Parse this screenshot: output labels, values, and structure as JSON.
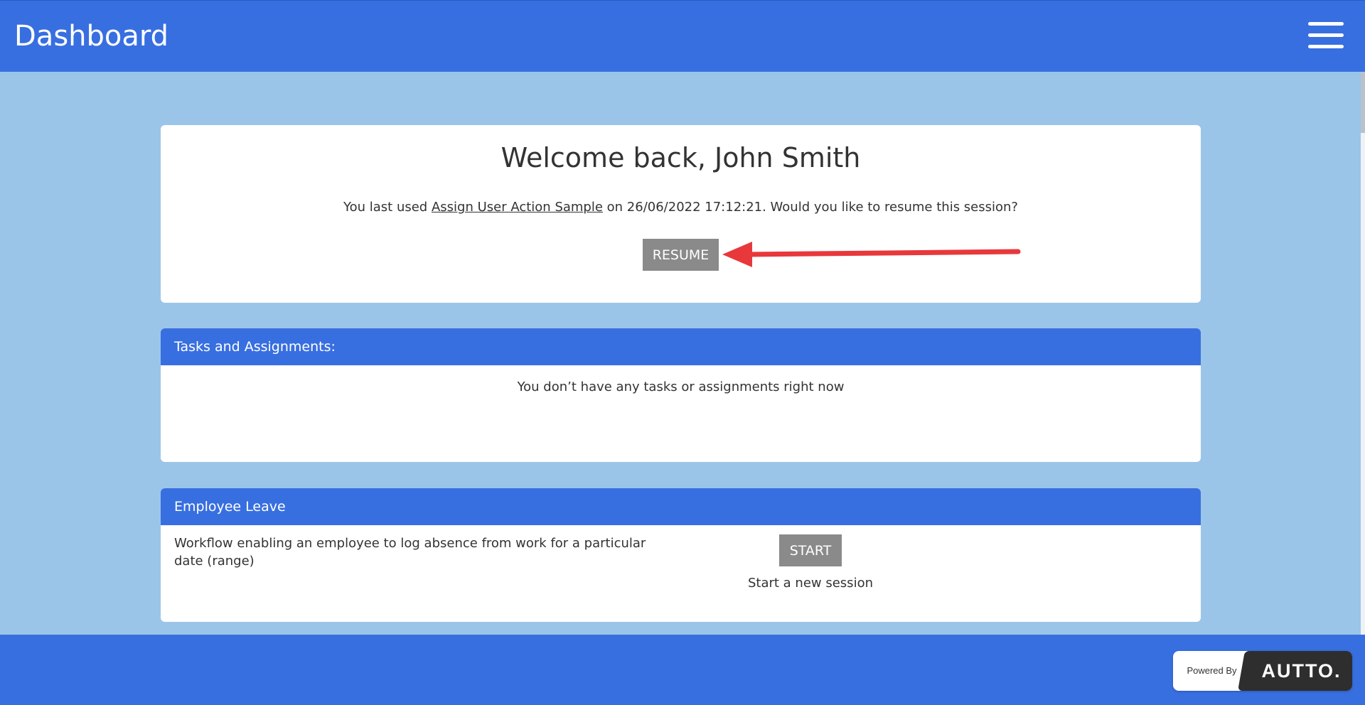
{
  "header": {
    "title": "Dashboard",
    "menu_icon": "hamburger-menu-icon"
  },
  "welcome": {
    "heading": "Welcome back, John Smith",
    "last_used_prefix": "You last used ",
    "last_used_link": "Assign User Action Sample",
    "last_used_suffix": " on 26/06/2022 17:12:21. Would you like to resume this session?",
    "resume_label": "RESUME",
    "annotation_icon": "arrow-left-icon"
  },
  "tasks": {
    "header": "Tasks and Assignments:",
    "empty_message": "You don’t have any tasks or assignments right now"
  },
  "leave": {
    "header": "Employee Leave",
    "description": "Workflow enabling an employee to log absence from work for a particular date (range)",
    "start_label": "START",
    "start_sub": "Start a new session"
  },
  "footer": {
    "powered_by": "Powered By",
    "brand": "AUTTO."
  },
  "colors": {
    "primary": "#386fe0",
    "background": "#9bc5e8",
    "button": "#8a8a8a",
    "arrow": "#e8383b",
    "brand_dark": "#2e2e2e"
  }
}
